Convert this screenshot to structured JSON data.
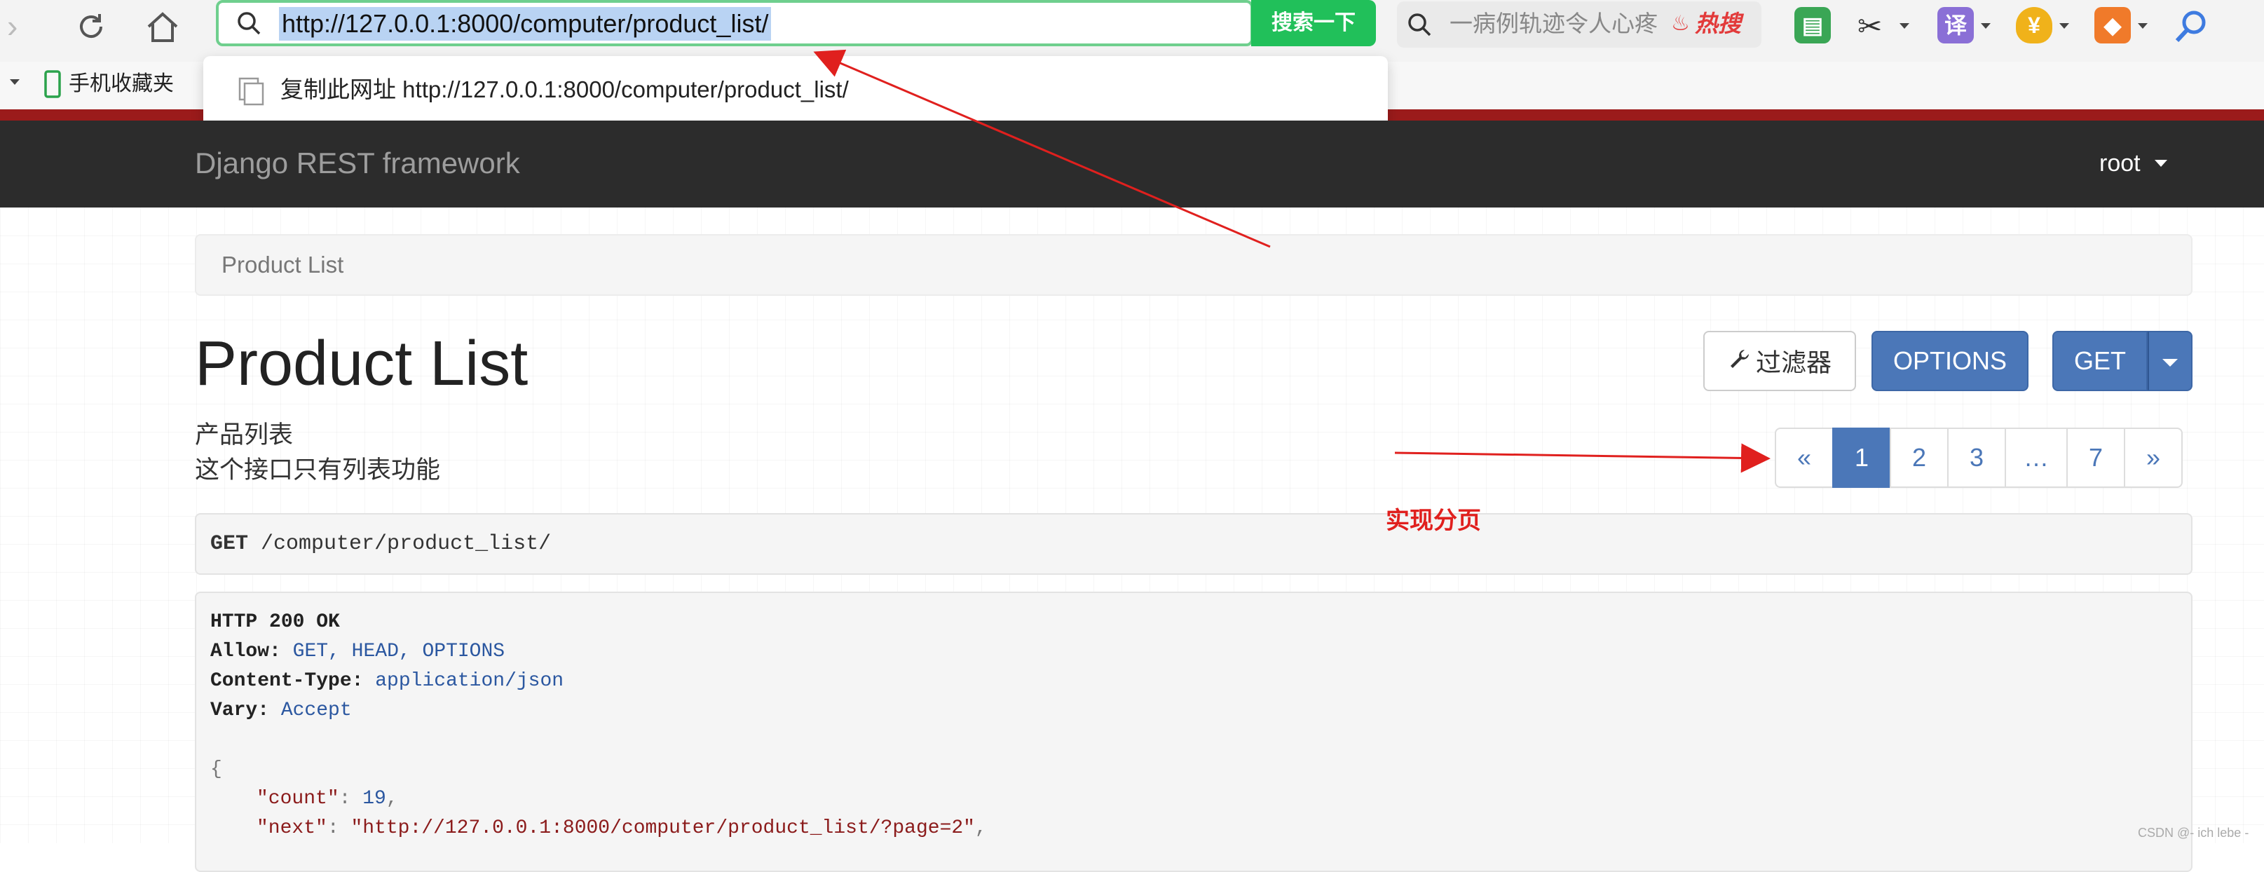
{
  "browser": {
    "url": "http://127.0.0.1:8000/computer/product_list/",
    "search_button": "搜索一下",
    "dropdown_copy": "复制此网址 http://127.0.0.1:8000/computer/product_list/",
    "hot_search_text": "一病例轨迹令人心疼",
    "hot_search_tag": "热搜",
    "bookmark_label": "手机收藏夹",
    "ext_translate": "译",
    "ext_coupon": "¥"
  },
  "navbar": {
    "brand": "Django REST framework",
    "user": "root"
  },
  "breadcrumb": "Product List",
  "page_title": "Product List",
  "description": {
    "line1": "产品列表",
    "line2": "这个接口只有列表功能"
  },
  "buttons": {
    "filter": "过滤器",
    "options": "OPTIONS",
    "get": "GET"
  },
  "pagination": {
    "prev": "«",
    "pages": [
      "1",
      "2",
      "3",
      "…",
      "7"
    ],
    "next": "»",
    "active": "1"
  },
  "request": {
    "method": "GET",
    "path": "/computer/product_list/"
  },
  "response": {
    "status": "HTTP 200 OK",
    "allow_key": "Allow:",
    "allow_val": "GET, HEAD, OPTIONS",
    "ctype_key": "Content-Type:",
    "ctype_val": "application/json",
    "vary_key": "Vary:",
    "vary_val": "Accept",
    "open_brace": "{",
    "count_key": "\"count\"",
    "count_val": "19",
    "next_key": "\"next\"",
    "next_val": "\"http://127.0.0.1:8000/computer/product_list/?page=2\""
  },
  "annotation": "实现分页",
  "watermark": "CSDN @- ich lebe -",
  "colors": {
    "accent_blue": "#4b77b8",
    "navbar_bg": "#2c2c2c",
    "annotation_red": "#e0201e",
    "search_green": "#21c05a"
  }
}
